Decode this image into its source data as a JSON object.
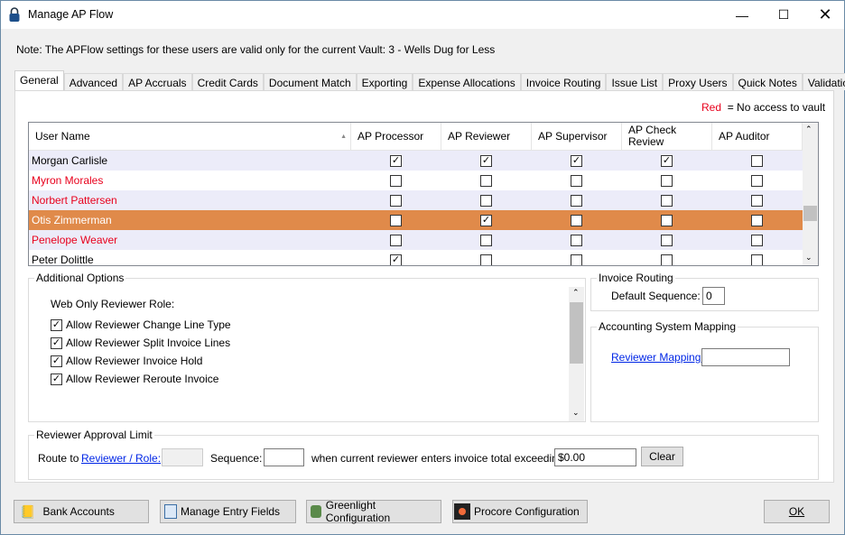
{
  "window": {
    "title": "Manage AP Flow",
    "icon": "lock-icon"
  },
  "note": "Note:  The APFlow settings for these users are valid only for the current Vault: 3 - Wells Dug for Less",
  "tabs": [
    "General",
    "Advanced",
    "AP Accruals",
    "Credit Cards",
    "Document Match",
    "Exporting",
    "Expense Allocations",
    "Invoice Routing",
    "Issue List",
    "Proxy Users",
    "Quick Notes",
    "Validation"
  ],
  "legend": {
    "red": "Red",
    "text": "= No access to vault"
  },
  "grid": {
    "columns": [
      "User Name",
      "AP Processor",
      "AP Reviewer",
      "AP Supervisor",
      "AP Check Review",
      "AP Auditor"
    ],
    "rows": [
      {
        "name": "Morgan Carlisle",
        "no_access": false,
        "selected": false,
        "checks": [
          true,
          true,
          true,
          true,
          false
        ]
      },
      {
        "name": "Myron Morales",
        "no_access": true,
        "selected": false,
        "checks": [
          false,
          false,
          false,
          false,
          false
        ]
      },
      {
        "name": "Norbert Pattersen",
        "no_access": true,
        "selected": false,
        "checks": [
          false,
          false,
          false,
          false,
          false
        ]
      },
      {
        "name": "Otis Zimmerman",
        "no_access": false,
        "selected": true,
        "checks": [
          false,
          true,
          false,
          false,
          false
        ]
      },
      {
        "name": "Penelope Weaver",
        "no_access": true,
        "selected": false,
        "checks": [
          false,
          false,
          false,
          false,
          false
        ]
      },
      {
        "name": "Peter Dolittle",
        "no_access": false,
        "selected": false,
        "checks": [
          true,
          false,
          false,
          false,
          false
        ]
      }
    ]
  },
  "additional": {
    "title": "Additional Options",
    "subtitle": "Web Only Reviewer Role:",
    "options": [
      {
        "label": "Allow Reviewer Change Line Type",
        "checked": true
      },
      {
        "label": "Allow Reviewer Split Invoice Lines",
        "checked": true
      },
      {
        "label": "Allow Reviewer Invoice Hold",
        "checked": true
      },
      {
        "label": "Allow Reviewer Reroute Invoice",
        "checked": true
      }
    ]
  },
  "routing": {
    "title": "Invoice Routing",
    "label": "Default Sequence:",
    "value": "0"
  },
  "mapping": {
    "title": "Accounting System Mapping",
    "link": "Reviewer Mapping:",
    "value": ""
  },
  "limit": {
    "title": "Reviewer Approval Limit",
    "route_to": "Route to",
    "link": "Reviewer / Role:",
    "sequence": "Sequence:",
    "text": "when current reviewer enters invoice total exceeding:",
    "amount": "$0.00",
    "clear": "Clear"
  },
  "buttons": {
    "bank": "Bank Accounts",
    "fields": "Manage Entry Fields",
    "greenlight": "Greenlight Configuration",
    "procore": "Procore Configuration",
    "ok": "OK"
  },
  "colors": {
    "selected": "#e08a4a",
    "alt_row": "#ececf9",
    "no_access": "#e8001c"
  }
}
